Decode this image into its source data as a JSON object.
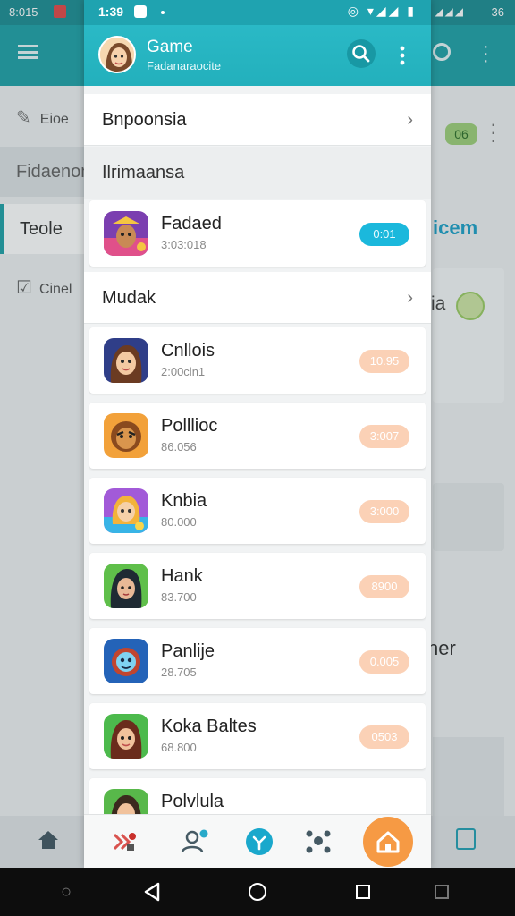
{
  "background": {
    "status_time": "8:015",
    "status_right": "36",
    "sidebar_items": [
      "Eioe",
      "Fidaenon",
      "Teole",
      "Cinel"
    ],
    "badge_count": "06",
    "word1": "icem",
    "word2": "ia",
    "word3": "her"
  },
  "status": {
    "time": "1:39"
  },
  "header": {
    "title": "Game",
    "subtitle": "Fadanaraocite"
  },
  "sections": {
    "first": "Bnpoonsia",
    "subhead": "Ilrimaansa",
    "second": "Mudak"
  },
  "featured": {
    "name": "Fadaed",
    "meta": "3:03:018",
    "pill": "0:01"
  },
  "games": [
    {
      "name": "Cnllois",
      "meta": "2:00cln1",
      "pill": "10.95"
    },
    {
      "name": "Polllioc",
      "meta": "86.056",
      "pill": "3:007"
    },
    {
      "name": "Knbia",
      "meta": "80.000",
      "pill": "3:000"
    },
    {
      "name": "Hank",
      "meta": "83.700",
      "pill": "8900"
    },
    {
      "name": "Panlije",
      "meta": "28.705",
      "pill": "0.005"
    },
    {
      "name": "Koka Baltes",
      "meta": "68.800",
      "pill": "0503"
    },
    {
      "name": "Polvlula",
      "meta": "",
      "pill": ""
    }
  ],
  "colors": {
    "header": "#23b0bc",
    "accent_pill": "#1bb8dc",
    "pill": "#fbd1b6",
    "home_button": "#f69a44"
  }
}
